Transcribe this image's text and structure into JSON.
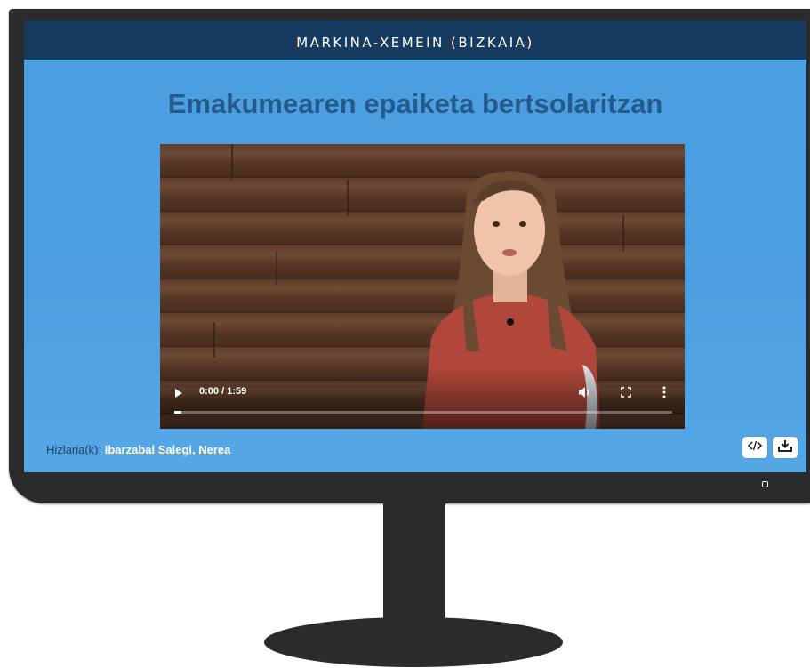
{
  "header": {
    "location": "MARKINA-XEMEIN (BIZKAIA)"
  },
  "page": {
    "title": "Emakumearen epaiketa bertsolaritzan"
  },
  "video": {
    "time_display": "0:00 / 1:59",
    "progress": 0.0,
    "icons": {
      "play": "play-icon",
      "volume": "volume-icon",
      "fullscreen": "fullscreen-icon",
      "menu": "more-vert-icon"
    }
  },
  "speaker": {
    "label": "Hizlaria(k):",
    "name": "Ibarzabal Salegi, Nerea"
  },
  "actions": {
    "embed_icon": "embed-code-icon",
    "download_icon": "download-icon"
  },
  "colors": {
    "header_bg": "#163b5f",
    "screen_bg": "#4a9fe0",
    "title": "#255b8c",
    "monitor": "#2b2b2b"
  }
}
